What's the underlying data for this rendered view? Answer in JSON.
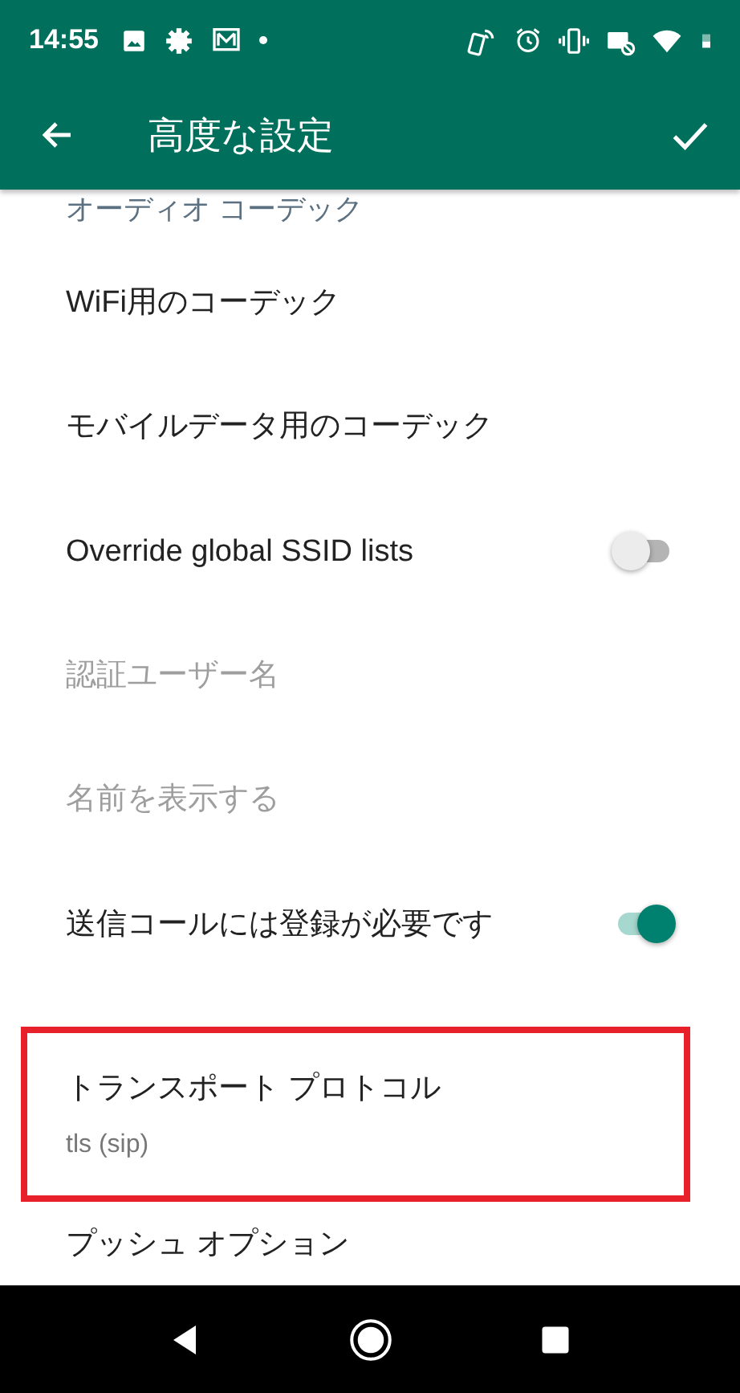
{
  "status_bar": {
    "time": "14:55"
  },
  "app_bar": {
    "title": "高度な設定"
  },
  "items": [
    {
      "kind": "category",
      "title": "オーディオ コーデック"
    },
    {
      "kind": "plain",
      "title": "WiFi用のコーデック",
      "disabled": false,
      "highlighted": false
    },
    {
      "kind": "plain",
      "title": "モバイルデータ用のコーデック",
      "disabled": false,
      "highlighted": false
    },
    {
      "kind": "switch",
      "title": "Override global SSID lists",
      "on": false,
      "disabled": false,
      "highlighted": false
    },
    {
      "kind": "plain",
      "title": "認証ユーザー名",
      "disabled": true,
      "highlighted": false
    },
    {
      "kind": "plain",
      "title": "名前を表示する",
      "disabled": true,
      "highlighted": false
    },
    {
      "kind": "switch",
      "title": "送信コールには登録が必要です",
      "on": true,
      "disabled": false,
      "highlighted": false
    },
    {
      "kind": "summary",
      "title": "トランスポート プロトコル",
      "summary": "tls (sip)",
      "disabled": false,
      "highlighted": true
    },
    {
      "kind": "plain",
      "title": "プッシュ オプション",
      "disabled": false,
      "highlighted": false
    }
  ]
}
